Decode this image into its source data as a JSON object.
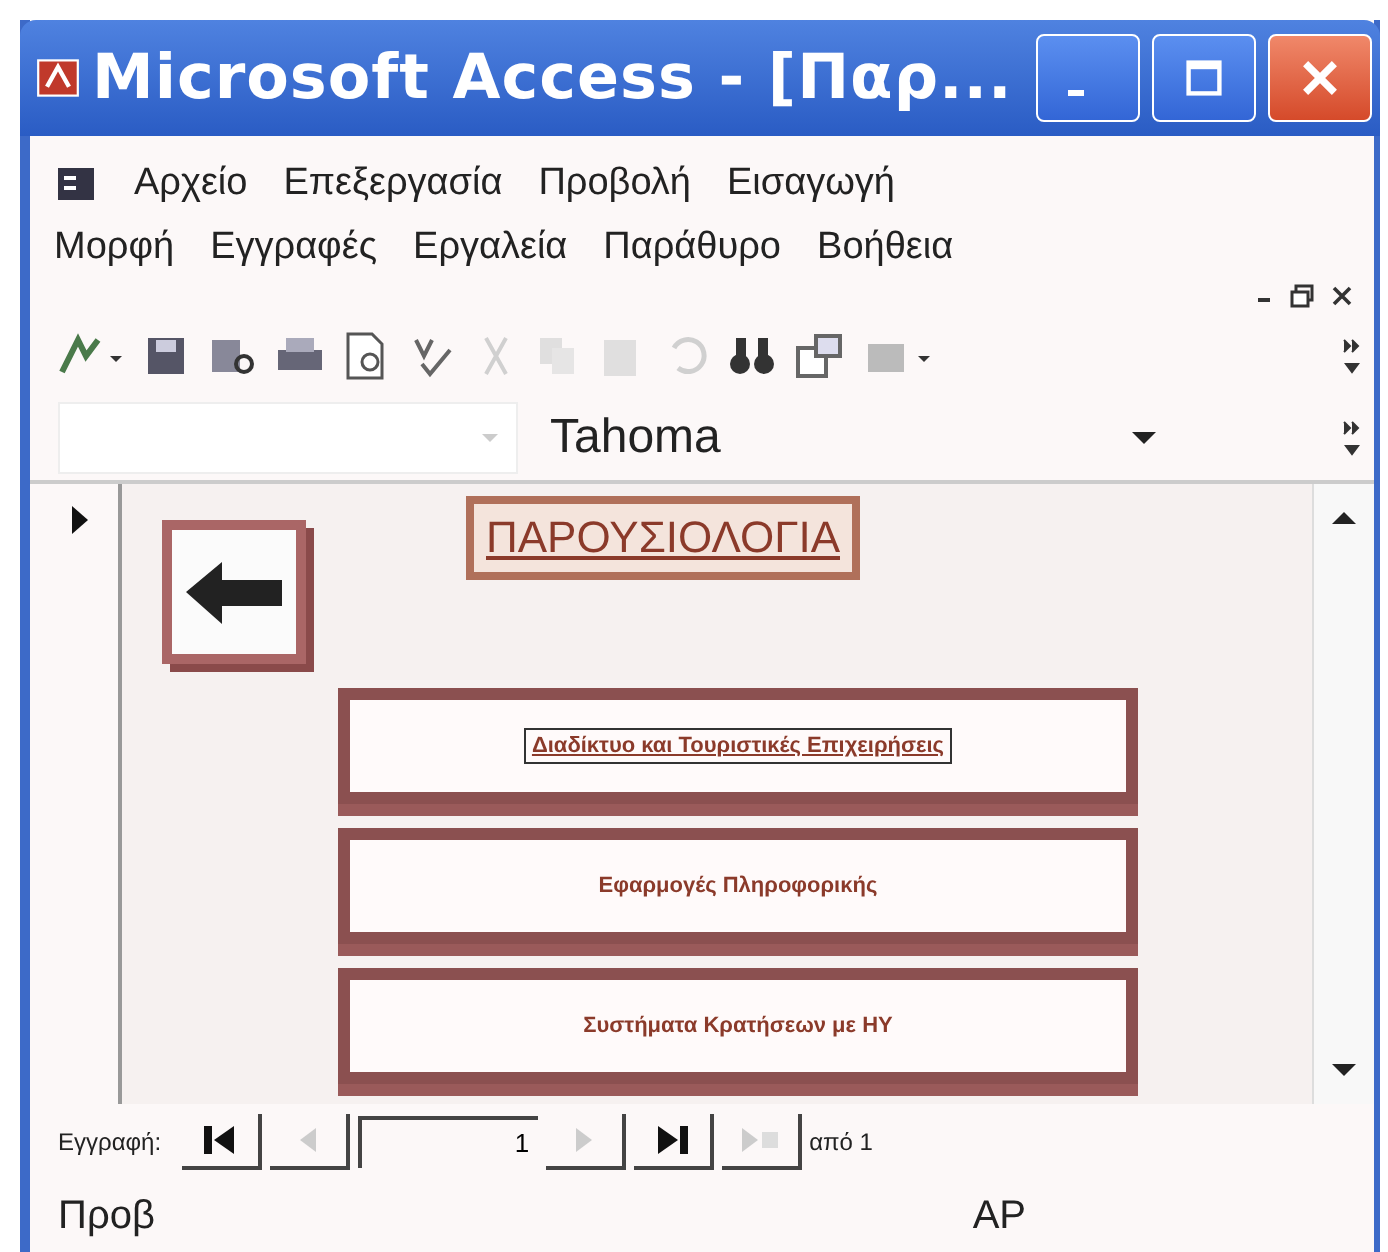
{
  "window": {
    "title": "Microsoft Access - [Παρ..."
  },
  "menu_bar": {
    "rows": [
      [
        "Αρχείο",
        "Επεξεργασία",
        "Προβολή",
        "Εισαγωγή"
      ],
      [
        "Μορφή",
        "Εγγραφές",
        "Εργαλεία",
        "Παράθυρο",
        "Βοήθεια"
      ]
    ]
  },
  "formatting_toolbar": {
    "font": "Tahoma"
  },
  "form": {
    "title": "ΠΑΡΟΥΣΙΟΛΟΓΙΑ",
    "buttons": [
      {
        "label": "Διαδίκτυο και Τουριστικές Επιχειρήσεις",
        "selected": true
      },
      {
        "label": "Εφαρμογές Πληροφορικής",
        "selected": false
      },
      {
        "label": "Συστήματα Κρατήσεων με ΗΥ",
        "selected": false
      }
    ]
  },
  "record_navigator": {
    "label": "Εγγραφή:",
    "current": "1",
    "total": "από 1"
  },
  "status_bar": {
    "left": "Προβ",
    "right": "ΑΡ"
  }
}
